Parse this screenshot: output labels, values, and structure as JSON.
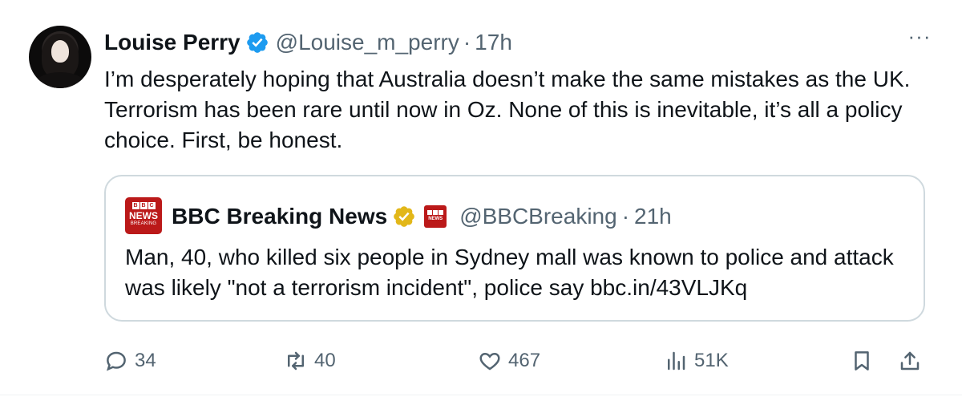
{
  "tweet": {
    "author_name": "Louise Perry",
    "handle": "@Louise_m_perry",
    "separator": "·",
    "time": "17h",
    "more_label": "···",
    "text": "I’m desperately hoping that Australia doesn’t make the same mistakes as the UK. Terrorism has been rare until now in Oz. None of this is inevitable, it’s all a policy choice. First, be honest."
  },
  "quote": {
    "logo_top": [
      "B",
      "B",
      "C"
    ],
    "logo_middle": "NEWS",
    "logo_bottom": "BREAKING",
    "mini_logo_text": "NEWS",
    "author_name": "BBC Breaking News",
    "handle": "@BBCBreaking",
    "separator": "·",
    "time": "21h",
    "text": "Man, 40, who killed six people in Sydney mall was known to police and attack was likely \"not a terrorism incident\", police say bbc.in/43VLJKq"
  },
  "actions": {
    "reply_count": "34",
    "repost_count": "40",
    "like_count": "467",
    "views_count": "51K"
  },
  "colors": {
    "verified_blue": "#1d9bf0",
    "verified_gold": "#e2b719",
    "bbc_red": "#bb1919",
    "secondary_text": "#536471",
    "border": "#cfd9de"
  },
  "icons": {
    "verified": "verified-badge-icon",
    "gold_verified": "gold-verified-badge-icon",
    "reply": "reply-icon",
    "repost": "repost-icon",
    "like": "heart-icon",
    "views": "views-icon",
    "bookmark": "bookmark-icon",
    "share": "share-icon",
    "more": "more-icon"
  }
}
